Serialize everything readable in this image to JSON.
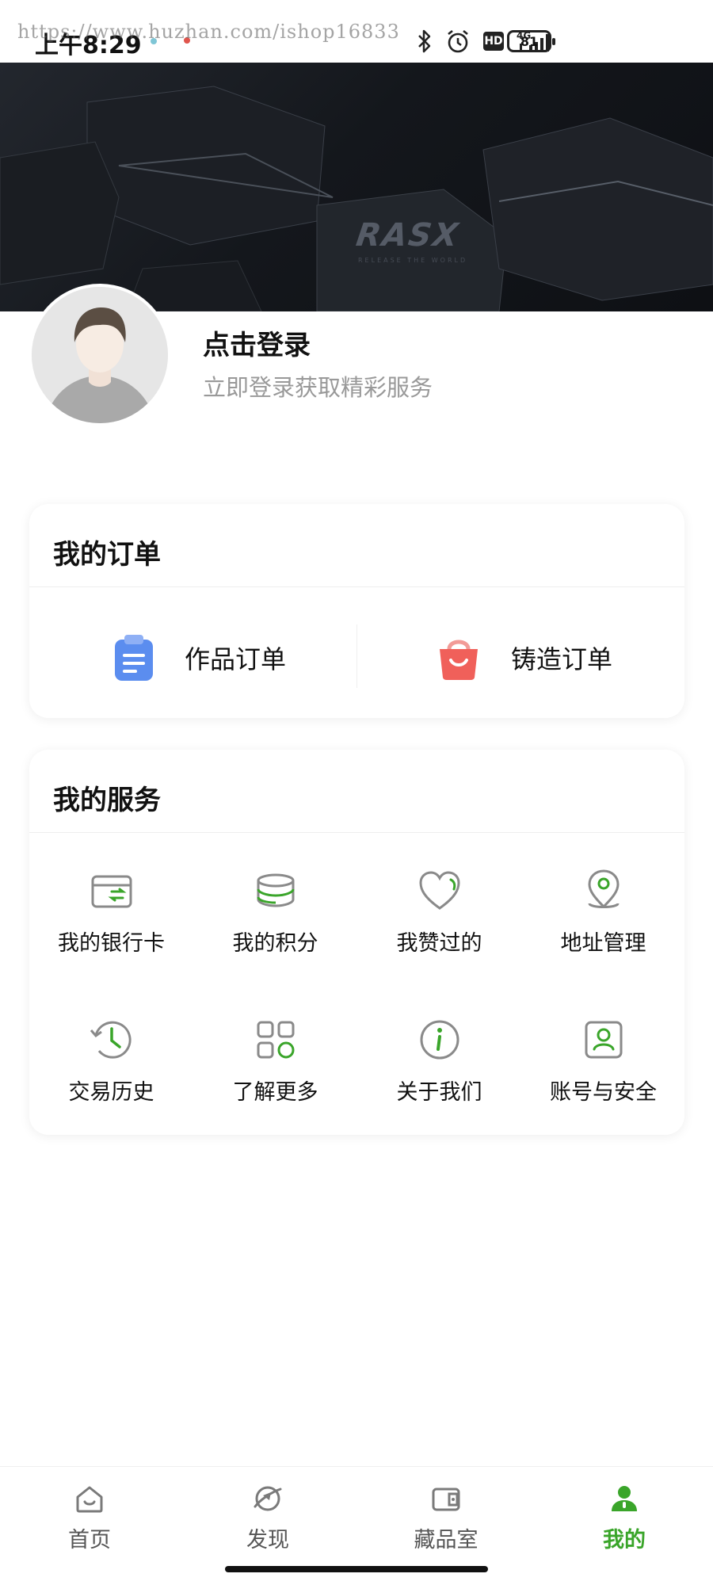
{
  "status_bar": {
    "time": "上午8:29",
    "watermark": "https://www.huzhan.com/ishop16833",
    "hd": "HD",
    "network": "4G",
    "battery": "81"
  },
  "banner": {
    "logo": "RASX",
    "logo_sub": "RELEASE THE WORLD"
  },
  "profile": {
    "title": "点击登录",
    "subtitle": "立即登录获取精彩服务"
  },
  "orders": {
    "title": "我的订单",
    "items": [
      {
        "label": "作品订单",
        "icon": "clipboard-icon"
      },
      {
        "label": "铸造订单",
        "icon": "shopping-bag-icon"
      }
    ]
  },
  "services": {
    "title": "我的服务",
    "items": [
      {
        "label": "我的银行卡",
        "icon": "bank-card-icon"
      },
      {
        "label": "我的积分",
        "icon": "points-stack-icon"
      },
      {
        "label": "我赞过的",
        "icon": "heart-icon"
      },
      {
        "label": "地址管理",
        "icon": "location-pin-icon"
      },
      {
        "label": "交易历史",
        "icon": "history-clock-icon"
      },
      {
        "label": "了解更多",
        "icon": "grid-apps-icon"
      },
      {
        "label": "关于我们",
        "icon": "info-icon"
      },
      {
        "label": "账号与安全",
        "icon": "account-security-icon"
      }
    ]
  },
  "nav": {
    "items": [
      {
        "label": "首页",
        "icon": "home-icon"
      },
      {
        "label": "发现",
        "icon": "discover-icon"
      },
      {
        "label": "藏品室",
        "icon": "collection-icon"
      },
      {
        "label": "我的",
        "icon": "profile-icon"
      }
    ],
    "active_color": "#3aa52a"
  },
  "colors": {
    "accent_green": "#3aa52a",
    "order_blue": "#5b8def",
    "order_red": "#f0605a",
    "icon_gray": "#8a8a8a"
  }
}
